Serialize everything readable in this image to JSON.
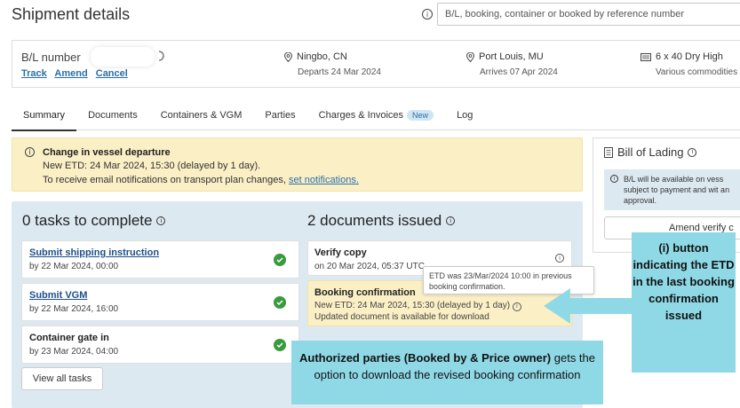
{
  "header": {
    "title": "Shipment details",
    "search_placeholder": "B/L, booking, container or booked by reference number"
  },
  "shipment": {
    "bl_label": "B/L number",
    "links": [
      "Track",
      "Amend",
      "Cancel"
    ],
    "origin": {
      "city": "Ningbo, CN",
      "sub": "Departs 24 Mar 2024"
    },
    "destination": {
      "city": "Port Louis, MU",
      "sub": "Arrives 07 Apr 2024"
    },
    "equipment": {
      "main": "6 x 40 Dry High",
      "sub": "Various commodities"
    }
  },
  "tabs": [
    {
      "label": "Summary"
    },
    {
      "label": "Documents"
    },
    {
      "label": "Containers & VGM"
    },
    {
      "label": "Parties"
    },
    {
      "label": "Charges & Invoices",
      "badge": "New"
    },
    {
      "label": "Log"
    }
  ],
  "alert": {
    "title": "Change in vessel departure",
    "line1": "New ETD: 24 Mar 2024, 15:30 (delayed by 1 day).",
    "line2": "To receive email notifications on transport plan changes,",
    "link": "set notifications."
  },
  "tasks": {
    "heading": "0 tasks to complete",
    "items": [
      {
        "name": "Submit shipping instruction",
        "date": "by 22 Mar 2024, 00:00"
      },
      {
        "name": "Submit VGM",
        "date": "by 22 Mar 2024, 16:00"
      },
      {
        "name": "Container gate in",
        "date": "by 23 Mar 2024, 04:00"
      }
    ],
    "view_all": "View all tasks"
  },
  "documents": {
    "heading": "2 documents issued",
    "verify": {
      "name": "Verify copy",
      "date": "on 20 Mar 2024, 05:37 UTC"
    },
    "booking": {
      "name": "Booking confirmation",
      "line1": "New ETD: 24 Mar 2024, 15:30 (delayed by 1 day)",
      "line2": "Updated document is available for download"
    },
    "tooltip": "ETD was 23/Mar/2024 10:00 in previous booking confirmation."
  },
  "bill_of_lading": {
    "title": "Bill of Lading",
    "note": "B/L will be available on vess subject to payment and wit an approval.",
    "button": "Amend verify c"
  },
  "callouts": {
    "right": "(i) button indicating the ETD in the last booking confirmation issued",
    "bottom_bold": "Authorized parties (Booked by & Price owner)",
    "bottom_rest": " gets the option to download the revised booking confirmation"
  },
  "colors": {
    "alert_bg": "#fbefc6",
    "panel_bg": "#dde9f1",
    "callout_bg": "#8fd9e6",
    "success": "#3a9a3e",
    "link": "#2a6fa8"
  }
}
